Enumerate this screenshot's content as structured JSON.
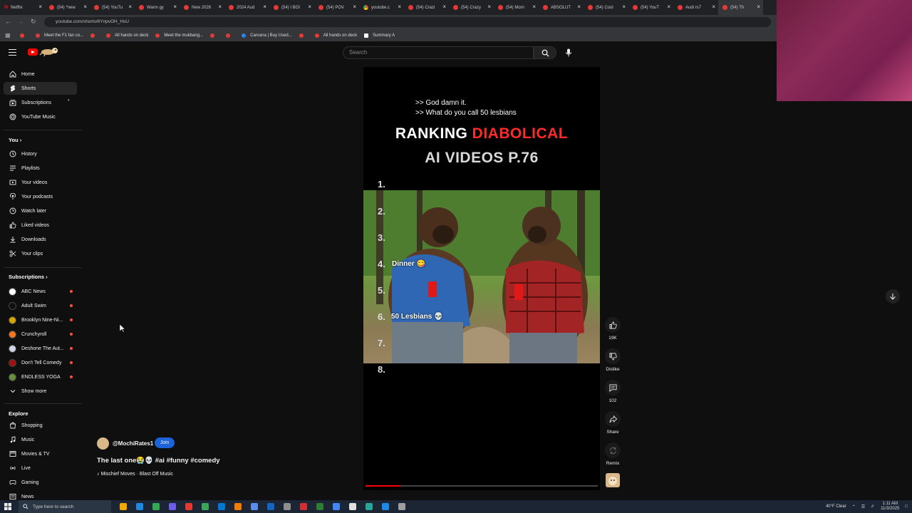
{
  "browser": {
    "tabs": [
      {
        "label": "Netflix",
        "fav": "netflix"
      },
      {
        "label": "(54) *new",
        "fav": "yt"
      },
      {
        "label": "(54) YouTu",
        "fav": "yt"
      },
      {
        "label": "Warm gy",
        "fav": "yt"
      },
      {
        "label": "New 2026",
        "fav": "yt"
      },
      {
        "label": "2024 Aud",
        "fav": "yt"
      },
      {
        "label": "(54) I BOI",
        "fav": "yt"
      },
      {
        "label": "(54) POV",
        "fav": "yt"
      },
      {
        "label": "youtube.c",
        "fav": "chrome"
      },
      {
        "label": "(54) Crazi",
        "fav": "yt"
      },
      {
        "label": "(54) Crazy",
        "fav": "yt"
      },
      {
        "label": "(54) Morn",
        "fav": "yt"
      },
      {
        "label": "ABSOLUT",
        "fav": "yt"
      },
      {
        "label": "(54) Cool",
        "fav": "yt"
      },
      {
        "label": "(54) YouT",
        "fav": "yt"
      },
      {
        "label": "Audi rs7",
        "fav": "yt"
      },
      {
        "label": "(54) Th",
        "fav": "yt",
        "active": true
      }
    ],
    "url": "youtube.com/shorts/6YnpvOH_HsU",
    "bookmarks": [
      {
        "label": "",
        "fav": "yt"
      },
      {
        "label": "Meet the F1 fan co...",
        "fav": "yt"
      },
      {
        "label": "",
        "fav": "yt"
      },
      {
        "label": "All hands on deck",
        "fav": "yt"
      },
      {
        "label": "Meet the mukbang...",
        "fav": "yt"
      },
      {
        "label": "",
        "fav": "yt"
      },
      {
        "label": "",
        "fav": "yt"
      },
      {
        "label": "Carvana | Buy Used...",
        "fav": "blue"
      },
      {
        "label": "",
        "fav": "yt"
      },
      {
        "label": "All hands on deck",
        "fav": "yt"
      },
      {
        "label": "Summary A",
        "fav": "white"
      }
    ]
  },
  "header": {
    "search_placeholder": "Search"
  },
  "sidebar": {
    "main": [
      {
        "label": "Home",
        "icon": "home-icon"
      },
      {
        "label": "Shorts",
        "icon": "shorts-icon",
        "active": true
      },
      {
        "label": "Subscriptions",
        "icon": "subscriptions-icon"
      },
      {
        "label": "YouTube Music",
        "icon": "youtube-music-icon"
      }
    ],
    "you_label": "You",
    "you": [
      {
        "label": "History",
        "icon": "history-icon"
      },
      {
        "label": "Playlists",
        "icon": "playlists-icon"
      },
      {
        "label": "Your videos",
        "icon": "your-videos-icon"
      },
      {
        "label": "Your podcasts",
        "icon": "podcasts-icon"
      },
      {
        "label": "Watch later",
        "icon": "watch-later-icon"
      },
      {
        "label": "Liked videos",
        "icon": "liked-videos-icon"
      },
      {
        "label": "Downloads",
        "icon": "downloads-icon"
      },
      {
        "label": "Your clips",
        "icon": "clips-icon"
      }
    ],
    "subscriptions_label": "Subscriptions",
    "subscriptions": [
      {
        "label": "ABC News",
        "color": "#ffffff"
      },
      {
        "label": "Adult Swim",
        "color": "#111111"
      },
      {
        "label": "Brooklyn Nine-Ni...",
        "color": "#d7a300"
      },
      {
        "label": "Crunchyroll",
        "color": "#f47521"
      },
      {
        "label": "Deshone The Aut...",
        "color": "#cfd8e6"
      },
      {
        "label": "Don't Tell Comedy",
        "color": "#a01010"
      },
      {
        "label": "ENDLESS YOGA",
        "color": "#6b8e3a"
      }
    ],
    "show_more": "Show more",
    "explore_label": "Explore",
    "explore": [
      {
        "label": "Shopping",
        "icon": "shopping-icon"
      },
      {
        "label": "Music",
        "icon": "music-icon"
      },
      {
        "label": "Movies & TV",
        "icon": "movies-icon"
      },
      {
        "label": "Live",
        "icon": "live-icon"
      },
      {
        "label": "Gaming",
        "icon": "gaming-icon"
      },
      {
        "label": "News",
        "icon": "news-icon"
      }
    ]
  },
  "video": {
    "caption_line1": ">> God damn it.",
    "caption_line2": ">> What do you call 50 lesbians",
    "title_word1": "RANKING",
    "title_word2": "DIABOLICAL",
    "title_line2": "AI VIDEOS P.76",
    "ranks": [
      "1.",
      "2.",
      "3.",
      "4.",
      "5.",
      "6.",
      "7.",
      "8."
    ],
    "label_dinner": "Dinner",
    "label_lesbians": "50 Lesbians",
    "progress": 0.15,
    "accent": "#ff2a2a"
  },
  "actions": {
    "like_count": "19K",
    "dislike_label": "Dislike",
    "comment_count": "102",
    "share_label": "Share",
    "remix_label": "Remix"
  },
  "channel": {
    "handle": "@MochiRates1",
    "join_label": "Join",
    "title": "The last one😭💀 #ai #funny #comedy",
    "music": "♪ Mischief Moves · Blast Off Music"
  },
  "taskbar": {
    "search_placeholder": "Type here to search",
    "weather": "40°F  Clear",
    "time": "1:11 AM",
    "date": "11/3/2025"
  }
}
